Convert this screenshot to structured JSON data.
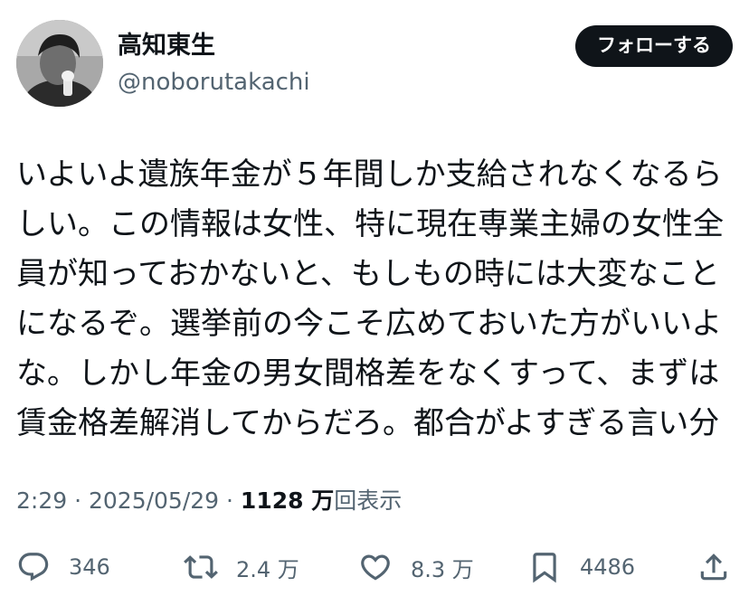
{
  "author": {
    "display_name": "高知東生",
    "handle": "@noborutakachi",
    "follow_label": "フォローする"
  },
  "tweet": {
    "lines": [
      "いよいよ遺族年金が５年間しか支給されなくなるら",
      "しい。この情報は女性、特に現在専業主婦の女性全",
      "員が知っておかないと、もしもの時には大変なこと",
      "になるぞ。選挙前の今こそ広めておいた方がいいよ",
      "な。しかし年金の男女間格差をなくすって、まずは",
      "賃金格差解消してからだろ。都合がよすぎる言い分"
    ]
  },
  "meta": {
    "time": "2:29",
    "separator": " · ",
    "date": "2025/05/29",
    "views_count": "1128 万",
    "views_label": "回表示"
  },
  "actions": {
    "reply": {
      "icon": "reply-icon",
      "count": "346"
    },
    "retweet": {
      "icon": "retweet-icon",
      "count": "2.4 万"
    },
    "like": {
      "icon": "heart-icon",
      "count": "8.3 万"
    },
    "bookmark": {
      "icon": "bookmark-icon",
      "count": "4486"
    },
    "share": {
      "icon": "share-icon"
    }
  },
  "colors": {
    "text": "#0f1419",
    "secondary": "#536471",
    "follow_bg": "#0f1419",
    "follow_text": "#ffffff"
  }
}
